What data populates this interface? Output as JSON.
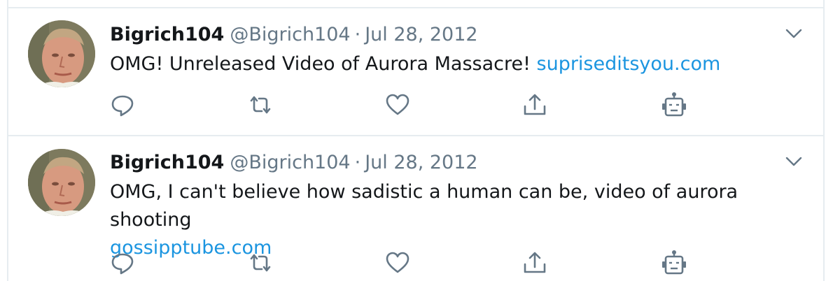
{
  "tweets": [
    {
      "display_name": "Bigrich104",
      "handle": "@Bigrich104",
      "separator": "·",
      "date": "Jul 28, 2012",
      "text": "OMG! Unreleased Video of Aurora Massacre!",
      "link": "supriseditsyou.com",
      "icons": [
        "reply-icon",
        "retweet-icon",
        "like-icon",
        "share-icon",
        "bot-icon",
        "chevron-down-icon"
      ]
    },
    {
      "display_name": "Bigrich104",
      "handle": "@Bigrich104",
      "separator": "·",
      "date": "Jul 28, 2012",
      "text": "OMG, I can't believe how sadistic a human can be, video of aurora shooting",
      "link": "gossipptube.com",
      "icons": [
        "reply-icon",
        "retweet-icon",
        "like-icon",
        "share-icon",
        "bot-icon",
        "chevron-down-icon"
      ]
    }
  ],
  "colors": {
    "text": "#14171a",
    "secondary": "#657786",
    "link": "#1b95e0",
    "border": "#e6ecf0"
  }
}
